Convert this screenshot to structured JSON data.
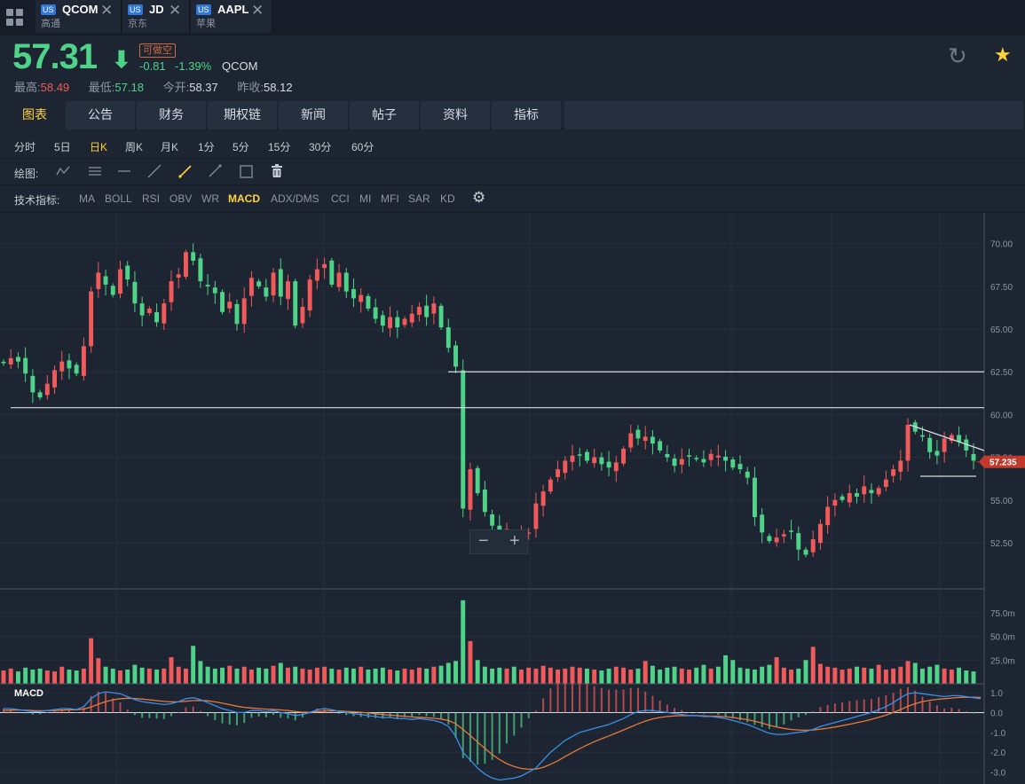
{
  "tabs": [
    {
      "market": "US",
      "code": "QCOM",
      "name": "高通"
    },
    {
      "market": "US",
      "code": "JD",
      "name": "京东"
    },
    {
      "market": "US",
      "code": "AAPL",
      "name": "苹果"
    }
  ],
  "quote": {
    "price": "57.31",
    "arrow": "⬇",
    "short_badge": "可做空",
    "change": "-0.81",
    "change_pct": "-1.39%",
    "code": "QCOM",
    "high_label": "最高:",
    "high": "58.49",
    "low_label": "最低:",
    "low": "57.18",
    "open_label": "今开:",
    "open": "58.37",
    "prev_label": "昨收:",
    "prev_close": "58.12"
  },
  "nav_tabs": [
    "图表",
    "公告",
    "财务",
    "期权链",
    "新闻",
    "帖子",
    "资料",
    "指标"
  ],
  "periods": [
    "分时",
    "5日",
    "日K",
    "周K",
    "月K",
    "1分",
    "5分",
    "15分",
    "30分",
    "60分"
  ],
  "active_period": "日K",
  "draw_label": "绘图:",
  "indicator_label": "技术指标:",
  "indicators": [
    "MA",
    "BOLL",
    "RSI",
    "OBV",
    "WR",
    "MACD",
    "ADX/DMS",
    "CCI",
    "MI",
    "MFI",
    "SAR",
    "KD"
  ],
  "active_indicator": "MACD",
  "icons": {
    "grid": "grid-icon",
    "refresh": "refresh-icon",
    "star": "star-icon",
    "settings": "gear-icon"
  },
  "colors": {
    "up": "#f05a5a",
    "down": "#4fd388",
    "accent": "#ffd23a",
    "price_tag": "#c0392b"
  },
  "chart_data": {
    "type": "candlestick",
    "price_axis_ticks": [
      "70.00",
      "67.50",
      "65.00",
      "62.50",
      "60.00",
      "57.50",
      "55.00",
      "52.50"
    ],
    "price_range": [
      49.8,
      71.8
    ],
    "last_price_tag": "57.235",
    "last_price": 57.235,
    "volume_axis_ticks": [
      "75.0m",
      "50.0m",
      "25.0m"
    ],
    "macd_label": "MACD",
    "macd_axis_ticks": [
      "1.0",
      "0.0",
      "-1.0",
      "-2.0",
      "-3.0"
    ],
    "macd_range": [
      -3.6,
      1.45
    ],
    "support_lines": [
      62.5,
      60.4
    ],
    "price_path": [
      63.0,
      63.3,
      63.1,
      62.4,
      61.3,
      61.0,
      61.8,
      62.6,
      63.1,
      62.7,
      62.4,
      64.0,
      67.2,
      68.3,
      67.6,
      67.0,
      68.5,
      67.9,
      66.5,
      65.8,
      66.2,
      65.4,
      66.5,
      67.8,
      68.2,
      69.5,
      69.0,
      67.8,
      67.5,
      67.1,
      66.0,
      66.6,
      65.3,
      66.8,
      68.0,
      67.5,
      66.9,
      68.3,
      66.9,
      67.8,
      65.2,
      66.3,
      67.9,
      68.5,
      68.8,
      67.6,
      68.3,
      67.2,
      66.8,
      67.0,
      66.2,
      65.6,
      65.2,
      65.7,
      65.1,
      65.6,
      65.9,
      66.3,
      65.7,
      66.5,
      65.1,
      63.9,
      62.8,
      54.5,
      56.8,
      55.4,
      54.3,
      53.5,
      52.6,
      53.3,
      52.9,
      53.0,
      53.1,
      54.8,
      55.5,
      56.2,
      56.8,
      57.3,
      57.6,
      57.6,
      57.3,
      57.5,
      57.1,
      56.9,
      57.2,
      58.0,
      58.9,
      58.6,
      58.7,
      58.3,
      57.9,
      57.5,
      57.0,
      57.4,
      57.6,
      57.4,
      57.2,
      57.7,
      57.6,
      57.3,
      56.9,
      56.8,
      56.3,
      54.0,
      53.1,
      52.6,
      52.8,
      53.0,
      53.2,
      52.1,
      51.8,
      52.7,
      53.6,
      54.6,
      55.0,
      55.0,
      55.4,
      55.2,
      55.8,
      55.4,
      55.7,
      56.2,
      56.8,
      57.3,
      59.4,
      59.0,
      58.7,
      57.8,
      57.6,
      58.6,
      58.8,
      58.4,
      57.9,
      57.3
    ],
    "volumes_m": [
      14,
      16,
      13,
      17,
      15,
      16,
      14,
      13,
      18,
      15,
      14,
      16,
      48,
      27,
      18,
      16,
      14,
      15,
      20,
      17,
      16,
      15,
      16,
      28,
      18,
      16,
      40,
      24,
      18,
      16,
      17,
      19,
      16,
      18,
      15,
      17,
      16,
      19,
      22,
      17,
      18,
      16,
      15,
      17,
      18,
      16,
      15,
      17,
      16,
      18,
      15,
      16,
      17,
      15,
      14,
      16,
      15,
      17,
      16,
      18,
      19,
      22,
      24,
      88,
      45,
      25,
      18,
      16,
      17,
      16,
      18,
      15,
      17,
      16,
      19,
      17,
      15,
      16,
      18,
      17,
      16,
      15,
      14,
      16,
      18,
      17,
      15,
      16,
      24,
      19,
      15,
      17,
      18,
      16,
      15,
      17,
      20,
      16,
      18,
      30,
      25,
      17,
      16,
      15,
      18,
      20,
      28,
      17,
      15,
      16,
      25,
      39,
      21,
      18,
      17,
      15,
      16,
      18,
      17,
      16,
      20,
      15,
      16,
      18,
      24,
      22,
      16,
      18,
      20,
      16,
      15,
      17,
      14,
      13,
      12
    ],
    "macd_dif": [
      0.2,
      0.2,
      0.15,
      0.1,
      0.05,
      0.05,
      0.1,
      0.15,
      0.2,
      0.2,
      0.15,
      0.3,
      0.7,
      0.95,
      1.05,
      1.0,
      0.95,
      0.8,
      0.65,
      0.55,
      0.5,
      0.45,
      0.4,
      0.45,
      0.55,
      0.7,
      0.75,
      0.65,
      0.5,
      0.35,
      0.2,
      0.1,
      0.0,
      0.0,
      0.1,
      0.1,
      0.05,
      0.1,
      0.0,
      -0.05,
      -0.15,
      -0.1,
      0.0,
      0.15,
      0.2,
      0.15,
      0.05,
      0.0,
      -0.05,
      -0.1,
      -0.15,
      -0.2,
      -0.25,
      -0.25,
      -0.3,
      -0.3,
      -0.35,
      -0.3,
      -0.35,
      -0.4,
      -0.5,
      -0.7,
      -1.2,
      -2.0,
      -2.4,
      -2.8,
      -3.1,
      -3.3,
      -3.4,
      -3.35,
      -3.3,
      -3.2,
      -3.0,
      -2.8,
      -2.4,
      -2.0,
      -1.7,
      -1.4,
      -1.2,
      -1.0,
      -0.9,
      -0.8,
      -0.7,
      -0.6,
      -0.45,
      -0.3,
      -0.1,
      0.05,
      0.1,
      0.1,
      0.05,
      0.0,
      -0.05,
      -0.1,
      -0.15,
      -0.15,
      -0.2,
      -0.2,
      -0.25,
      -0.3,
      -0.4,
      -0.5,
      -0.6,
      -0.75,
      -0.9,
      -1.05,
      -1.1,
      -1.1,
      -1.05,
      -1.0,
      -0.95,
      -0.85,
      -0.7,
      -0.6,
      -0.5,
      -0.4,
      -0.3,
      -0.2,
      -0.1,
      0.0,
      0.15,
      0.3,
      0.5,
      0.75,
      0.95,
      1.0,
      0.95,
      0.9,
      0.85,
      0.8,
      0.85,
      0.85,
      0.8,
      0.75,
      0.7
    ],
    "macd_dea": [
      0.1,
      0.12,
      0.13,
      0.12,
      0.1,
      0.09,
      0.09,
      0.1,
      0.12,
      0.14,
      0.14,
      0.17,
      0.28,
      0.42,
      0.55,
      0.64,
      0.7,
      0.72,
      0.71,
      0.68,
      0.64,
      0.6,
      0.56,
      0.54,
      0.54,
      0.57,
      0.6,
      0.61,
      0.59,
      0.54,
      0.47,
      0.4,
      0.32,
      0.26,
      0.23,
      0.2,
      0.17,
      0.16,
      0.13,
      0.1,
      0.05,
      0.02,
      0.02,
      0.05,
      0.08,
      0.09,
      0.08,
      0.06,
      0.04,
      0.01,
      -0.02,
      -0.06,
      -0.1,
      -0.13,
      -0.16,
      -0.19,
      -0.22,
      -0.24,
      -0.26,
      -0.29,
      -0.33,
      -0.4,
      -0.56,
      -0.85,
      -1.16,
      -1.49,
      -1.81,
      -2.11,
      -2.37,
      -2.57,
      -2.72,
      -2.82,
      -2.86,
      -2.85,
      -2.76,
      -2.61,
      -2.43,
      -2.22,
      -2.02,
      -1.82,
      -1.64,
      -1.47,
      -1.32,
      -1.18,
      -1.03,
      -0.88,
      -0.72,
      -0.57,
      -0.43,
      -0.32,
      -0.25,
      -0.2,
      -0.17,
      -0.16,
      -0.16,
      -0.16,
      -0.17,
      -0.18,
      -0.19,
      -0.21,
      -0.25,
      -0.3,
      -0.36,
      -0.44,
      -0.53,
      -0.64,
      -0.73,
      -0.8,
      -0.85,
      -0.88,
      -0.89,
      -0.88,
      -0.84,
      -0.79,
      -0.73,
      -0.66,
      -0.59,
      -0.51,
      -0.43,
      -0.34,
      -0.24,
      -0.13,
      0.0,
      0.15,
      0.31,
      0.45,
      0.55,
      0.62,
      0.67,
      0.7,
      0.73,
      0.76,
      0.77,
      0.77,
      0.76
    ]
  }
}
